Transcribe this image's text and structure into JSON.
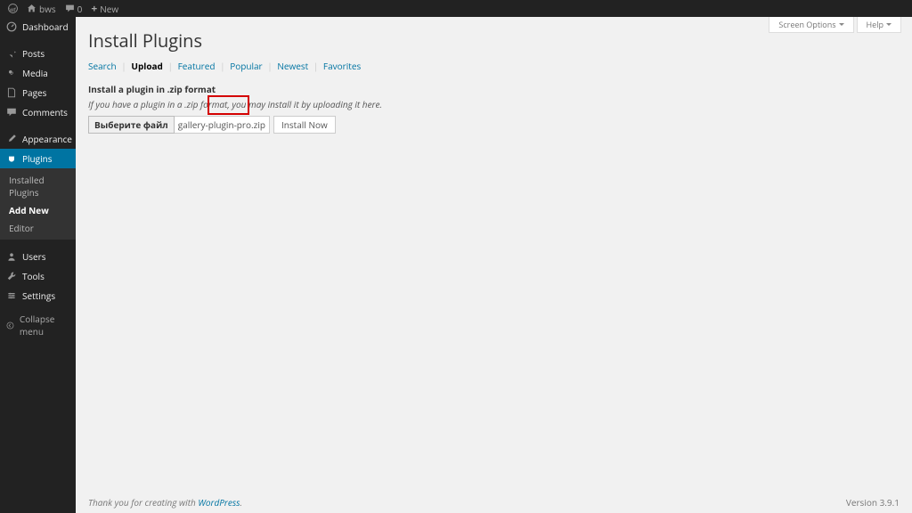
{
  "adminbar": {
    "site_name": "bws",
    "comments_count": "0",
    "new_label": "New"
  },
  "sidebar": {
    "items": [
      {
        "label": "Dashboard"
      },
      {
        "label": "Posts"
      },
      {
        "label": "Media"
      },
      {
        "label": "Pages"
      },
      {
        "label": "Comments"
      },
      {
        "label": "Appearance"
      },
      {
        "label": "Plugins"
      },
      {
        "label": "Users"
      },
      {
        "label": "Tools"
      },
      {
        "label": "Settings"
      }
    ],
    "plugins_submenu": [
      {
        "label": "Installed Plugins"
      },
      {
        "label": "Add New"
      },
      {
        "label": "Editor"
      }
    ],
    "collapse_label": "Collapse menu"
  },
  "screen_meta": {
    "screen_options": "Screen Options",
    "help": "Help"
  },
  "page": {
    "title": "Install Plugins",
    "filters": {
      "search": "Search",
      "upload": "Upload",
      "featured": "Featured",
      "popular": "Popular",
      "newest": "Newest",
      "favorites": "Favorites"
    },
    "upload_heading": "Install a plugin in .zip format",
    "upload_desc": "If you have a plugin in a .zip format, you may install it by uploading it here.",
    "choose_file_label": "Выберите файл",
    "selected_file": "gallery-plugin-pro.zip",
    "install_button": "Install Now"
  },
  "footer": {
    "thanks_prefix": "Thank you for creating with ",
    "wordpress": "WordPress",
    "thanks_suffix": ".",
    "version": "Version 3.9.1"
  }
}
